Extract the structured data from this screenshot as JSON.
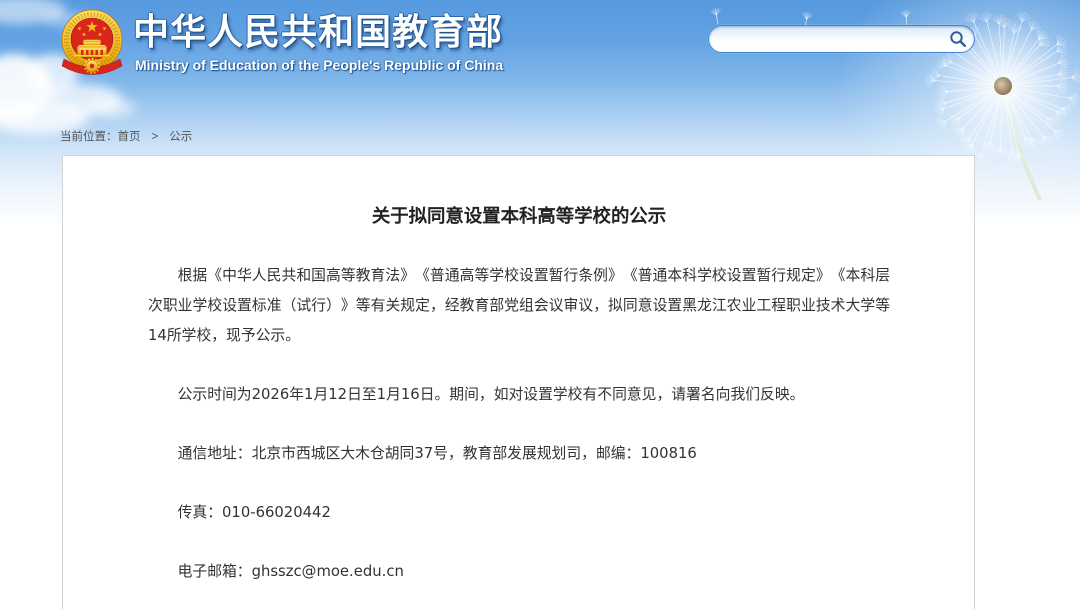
{
  "header": {
    "title_cn": "中华人民共和国教育部",
    "title_en": "Ministry of Education of the People's Republic of China",
    "emblem_icon": "national-emblem-icon"
  },
  "search": {
    "value": "",
    "button_icon": "search-icon"
  },
  "breadcrumb": {
    "prefix": "当前位置：",
    "items": [
      "首页",
      "公示"
    ],
    "separator": ">"
  },
  "article": {
    "title": "关于拟同意设置本科高等学校的公示",
    "paragraphs": [
      "根据《中华人民共和国高等教育法》《普通高等学校设置暂行条例》《普通本科学校设置暂行规定》《本科层次职业学校设置标准（试行）》等有关规定，经教育部党组会议审议，拟同意设置黑龙江农业工程职业技术大学等14所学校，现予公示。",
      "公示时间为2026年1月12日至1月16日。期间，如对设置学校有不同意见，请署名向我们反映。",
      "通信地址：北京市西城区大木仓胡同37号，教育部发展规划司，邮编：100816",
      "传真：010-66020442",
      "电子邮箱：ghsszc@moe.edu.cn"
    ]
  },
  "colors": {
    "sky_top": "#5799de",
    "sky_bottom": "#eef5fc",
    "title_outline": "#1b4f8c",
    "search_border": "#3f85cf",
    "breadcrumb_text": "#555555",
    "article_title": "#222222",
    "body_text": "#333333",
    "content_border": "#d3d3d3",
    "emblem_red": "#d9261c",
    "emblem_gold": "#f6c21c"
  }
}
